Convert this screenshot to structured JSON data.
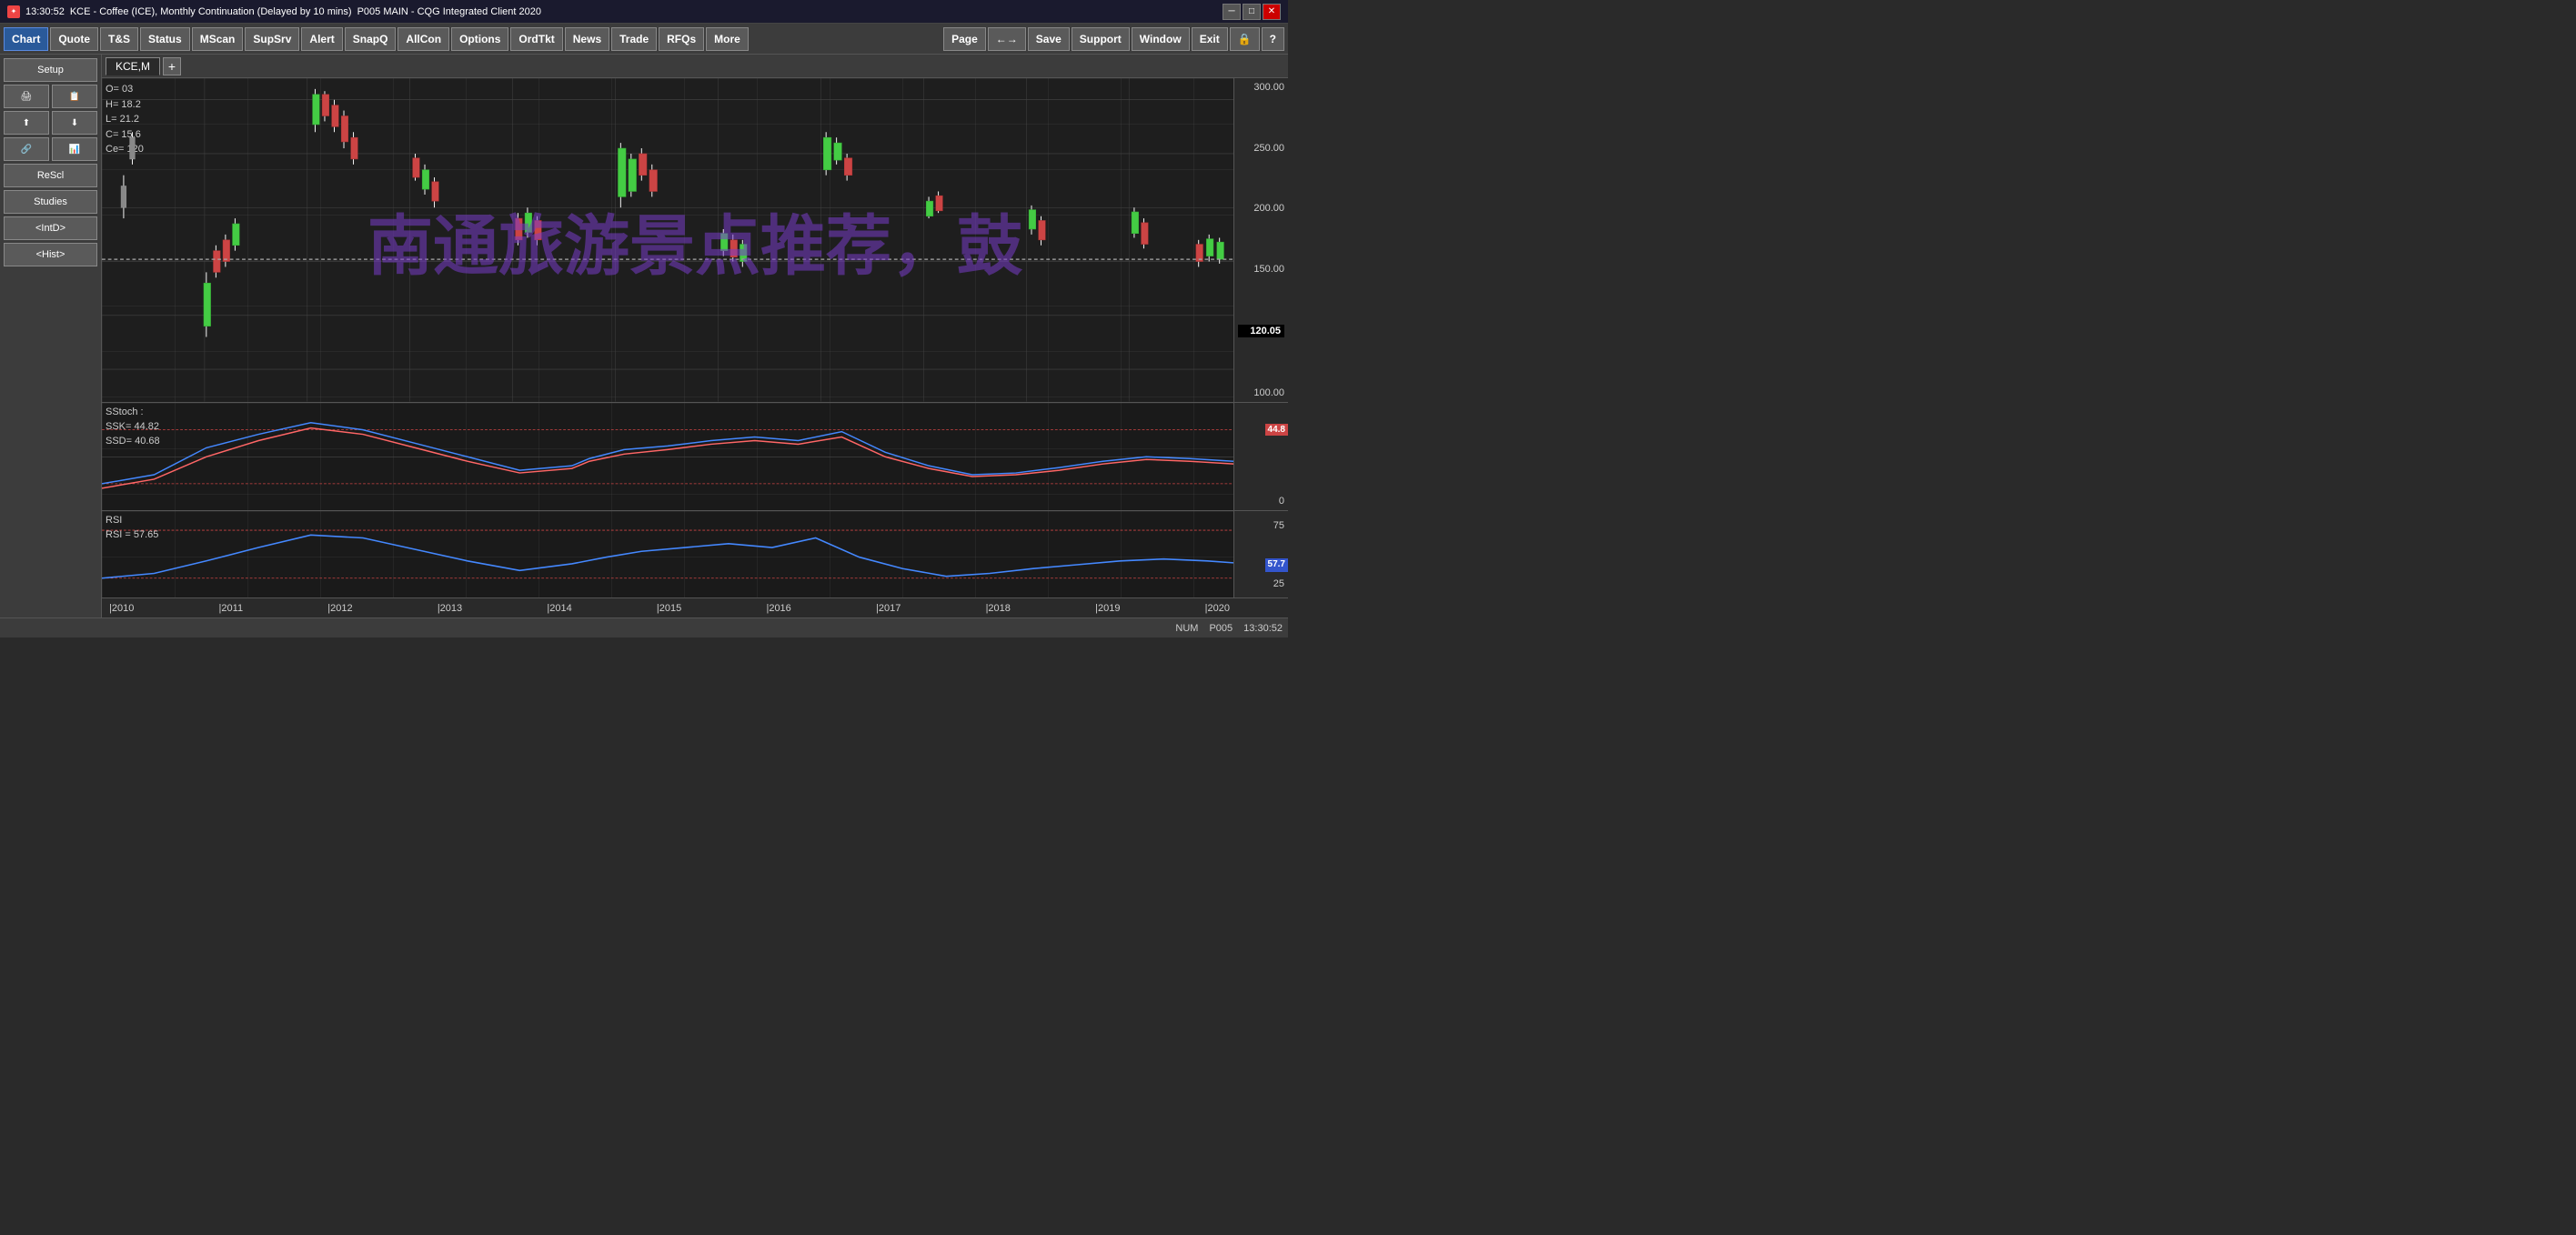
{
  "titleBar": {
    "time": "13:30:52",
    "symbol": "KCE - Coffee (ICE), Monthly Continuation (Delayed by 10 mins)",
    "page": "P005 MAIN - CQG Integrated Client 2020",
    "minimizeBtn": "─",
    "maximizeBtn": "□",
    "closeBtn": "✕"
  },
  "toolbar": {
    "buttons": [
      "Chart",
      "Quote",
      "T&S",
      "Status",
      "MScan",
      "SupSrv",
      "Alert",
      "SnapQ",
      "AllCon",
      "Options",
      "OrdTkt",
      "News",
      "Trade",
      "RFQs",
      "More"
    ],
    "rightButtons": [
      "Page",
      "←→",
      "Save",
      "Support",
      "Window",
      "Exit"
    ]
  },
  "sidebar": {
    "setupLabel": "Setup",
    "buttons": [
      "ReScl",
      "Studies",
      "<IntD>",
      "<Hist>"
    ],
    "iconRows": [
      [
        "🖨",
        ""
      ],
      [
        "📋",
        ""
      ],
      [
        "⬆",
        "⬇"
      ],
      [
        "🔗",
        "📊"
      ]
    ]
  },
  "chartTab": {
    "symbol": "KCE,M",
    "addLabel": "+"
  },
  "chartInfo": {
    "open": "O=",
    "high": "H=",
    "low": "L=",
    "close": "C=",
    "delta": "Δ=",
    "currentPrice": "120.05",
    "cursor": {
      "o": "O= 03",
      "h": "H= 18.2",
      "l": "L= 21.2",
      "c": "C= 15.6",
      "delta": "Ce= 120"
    }
  },
  "priceScale": {
    "labels": [
      "300.00",
      "250.00",
      "200.00",
      "150.00",
      "100.00"
    ]
  },
  "stoch": {
    "label": "SStoch :",
    "ssk": "SSK=",
    "sskValue": "44.82",
    "ssd": "SSD=",
    "ssdValue": "40.68",
    "scaleLabels": [
      "0"
    ],
    "badge": "44.8"
  },
  "rsi": {
    "label": "RSI",
    "rsLabel": "RSI =",
    "rsValue": "57.65",
    "scaleLabels": [
      "75",
      "25"
    ],
    "badge": "57.7"
  },
  "xAxisLabels": [
    "|2010",
    "|2011",
    "|2012",
    "|2013",
    "|2014",
    "|2015",
    "|2016",
    "|2017",
    "|2018",
    "|2019",
    "|2020"
  ],
  "watermark": "南通旅游景点推荐，鼓",
  "statusBar": {
    "num": "NUM",
    "page": "P005",
    "time": "13:30:52"
  }
}
